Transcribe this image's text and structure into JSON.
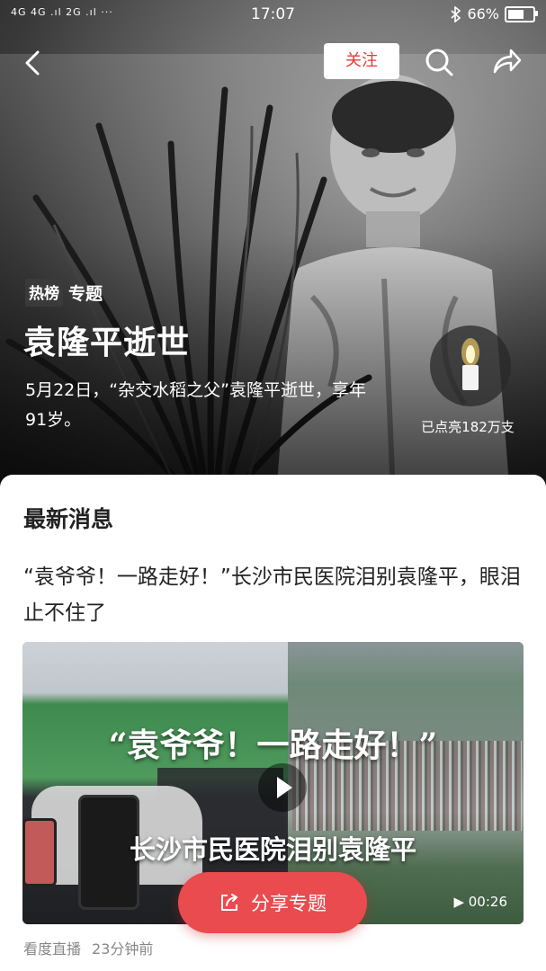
{
  "status_bar": {
    "network": "4G 4G .ıl 2G .ıl ···",
    "time": "17:07",
    "battery": "66%",
    "battery_level": 0.66
  },
  "header": {
    "follow_label": "关注"
  },
  "hero": {
    "tag_hot": "热榜",
    "tag_topic": "专题",
    "title": "袁隆平逝世",
    "description": "5月22日，“杂交水稻之父”袁隆平逝世，享年91岁。",
    "candle_count": "已点亮182万支"
  },
  "news": {
    "section_title": "最新消息",
    "headline": "“袁爷爷！一路走好！”长沙市民医院泪别袁隆平，眼泪止不住了",
    "video_caption_top": "“袁爷爷！一路走好！”",
    "video_caption_bottom": "长沙市民医院泪别袁隆平",
    "duration": "00:26",
    "source": "看度直播",
    "time_ago": "23分钟前"
  },
  "share_button": {
    "label": "分享专题"
  },
  "colors": {
    "accent": "#e94b4f",
    "follow_text": "#e53935"
  }
}
